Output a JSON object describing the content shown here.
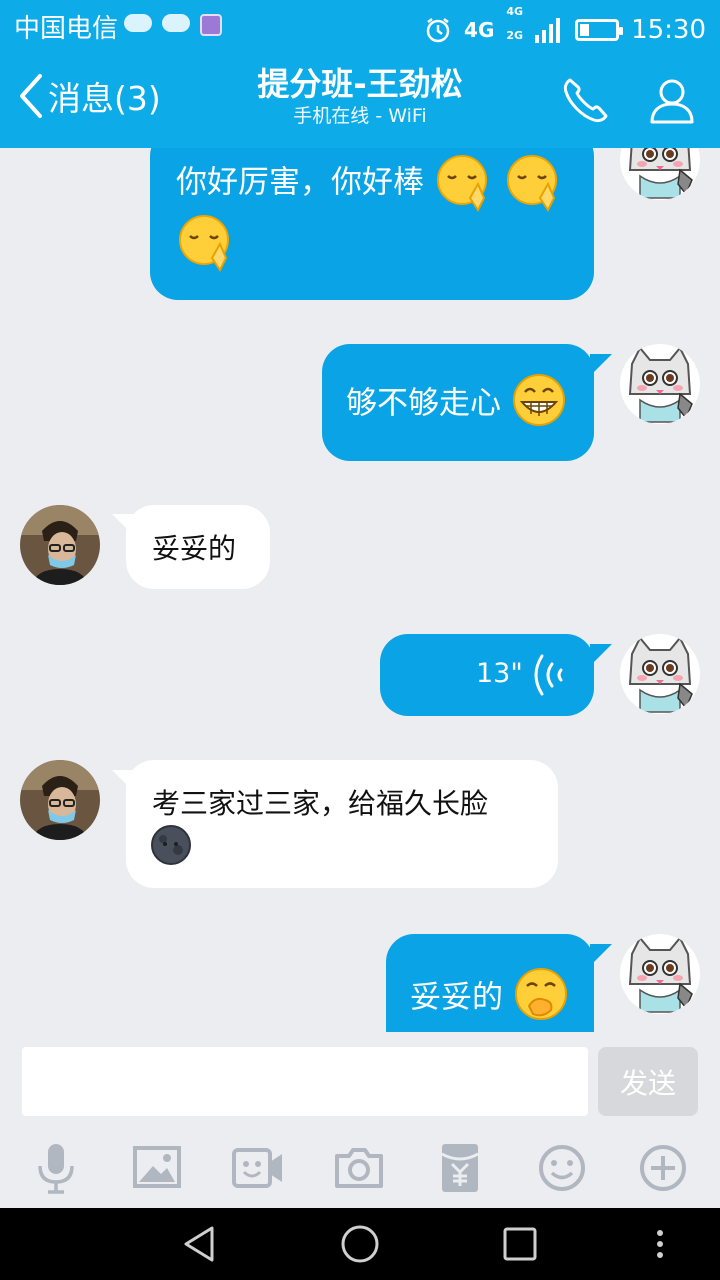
{
  "status_bar": {
    "carrier": "中国电信",
    "network": "4G",
    "network_small_top": "4G",
    "network_small_bottom": "2G",
    "time": "15:30",
    "battery_level": 0.25
  },
  "header": {
    "back_label": "消息(3)",
    "title": "提分班-王劲松",
    "subtitle": "手机在线 - WiFi"
  },
  "messages": [
    {
      "side": "out",
      "text": "你好厉害，你好棒",
      "emoji": [
        "pray-emoji",
        "pray-emoji",
        "pray-emoji"
      ]
    },
    {
      "side": "out",
      "text": "够不够走心",
      "emoji": [
        "grin-emoji"
      ]
    },
    {
      "side": "in",
      "text": "妥妥的"
    },
    {
      "side": "out",
      "type": "voice",
      "duration": "13\""
    },
    {
      "side": "in",
      "text": "考三家过三家，给福久长脸",
      "emoji": [
        "moon-emoji"
      ]
    },
    {
      "side": "out",
      "text": "妥妥的",
      "emoji": [
        "giggle-emoji"
      ]
    }
  ],
  "input": {
    "placeholder": "",
    "send_label": "发送"
  },
  "toolbar": [
    "mic-icon",
    "image-icon",
    "video-icon",
    "camera-icon",
    "red-packet-icon",
    "emoji-icon",
    "plus-icon"
  ],
  "colors": {
    "brand": "#0dabe7",
    "bubble_out": "#0aa3e5",
    "bubble_in": "#ffffff",
    "background": "#ebedf1"
  }
}
